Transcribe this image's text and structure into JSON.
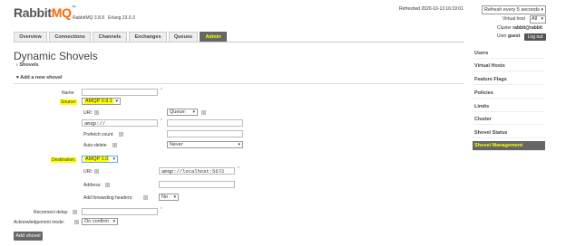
{
  "header": {
    "logo_main": "Rabbit",
    "logo_accent": "MQ",
    "tm": "™",
    "version": "RabbitMQ 3.8.8",
    "erlang": "Erlang 23.0.3",
    "refreshed": "Refreshed 2020-10-13 16:19:01",
    "refresh_option": "Refresh every 5 seconds",
    "vhost_label": "Virtual host",
    "vhost_value": "All",
    "cluster_label": "Cluster",
    "cluster_value": "rabbit@rabbit",
    "user_label": "User",
    "user_value": "guest",
    "logout": "Log out"
  },
  "tabs": [
    "Overview",
    "Connections",
    "Channels",
    "Exchanges",
    "Queues",
    "Admin"
  ],
  "active_tab": "Admin",
  "page": {
    "title": "Dynamic Shovels",
    "shovels_section": "Shovels",
    "add_section": "Add a new shovel"
  },
  "form": {
    "name_label": "Name:",
    "source_label": "Source:",
    "source_protocol": "AMQP 0.9.1",
    "uri_label": "URI:",
    "source_type": "Queue:",
    "source_uri": "amqp://",
    "prefetch_label": "Prefetch count:",
    "autodelete_label": "Auto-delete",
    "autodelete_value": "Never",
    "destination_label": "Destination:",
    "dest_protocol": "AMQP 1.0",
    "dest_uri": "amqp://localhost:5672",
    "address_label": "Address:",
    "fwd_headers_label": "Add forwarding headers:",
    "fwd_headers_value": "No",
    "reconnect_label": "Reconnect delay:",
    "ack_label": "Acknowledgement mode:",
    "ack_value": "On confirm",
    "add_button": "Add shovel",
    "required": "*",
    "help": "?"
  },
  "sidebar": {
    "items": [
      "Users",
      "Virtual Hosts",
      "Feature Flags",
      "Policies",
      "Limits",
      "Cluster",
      "Shovel Status",
      "Shovel Management"
    ],
    "active": "Shovel Management"
  },
  "colors": {
    "accent": "#ff6600",
    "highlight": "#ffff00",
    "active_bg": "#666666"
  }
}
